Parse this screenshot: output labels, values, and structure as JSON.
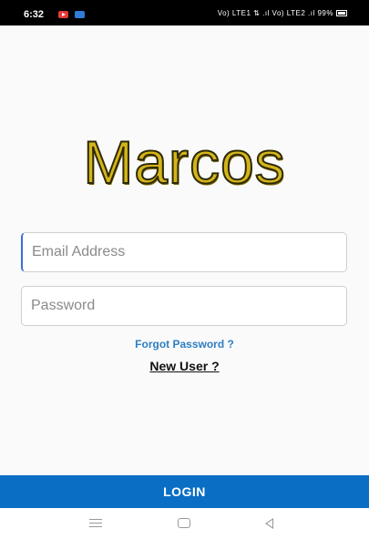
{
  "status_bar": {
    "time": "6:32",
    "right_text": "Vo) LTE1 ⇅ .ıl Vo) LTE2 .ıl 99%"
  },
  "logo": {
    "text": "Marcos"
  },
  "form": {
    "email_placeholder": "Email Address",
    "password_placeholder": "Password",
    "forgot_password": "Forgot Password ?",
    "new_user": "New User ?"
  },
  "login_button": "LOGIN",
  "icons": {
    "notifications": [
      "youtube-icon",
      "message-icon"
    ],
    "nav": [
      "menu-icon",
      "home-icon",
      "back-icon"
    ]
  },
  "colors": {
    "primary": "#0a6ec4",
    "link": "#2f7fc3",
    "logo_gold": "#d4b51a",
    "background": "#fafafa"
  }
}
